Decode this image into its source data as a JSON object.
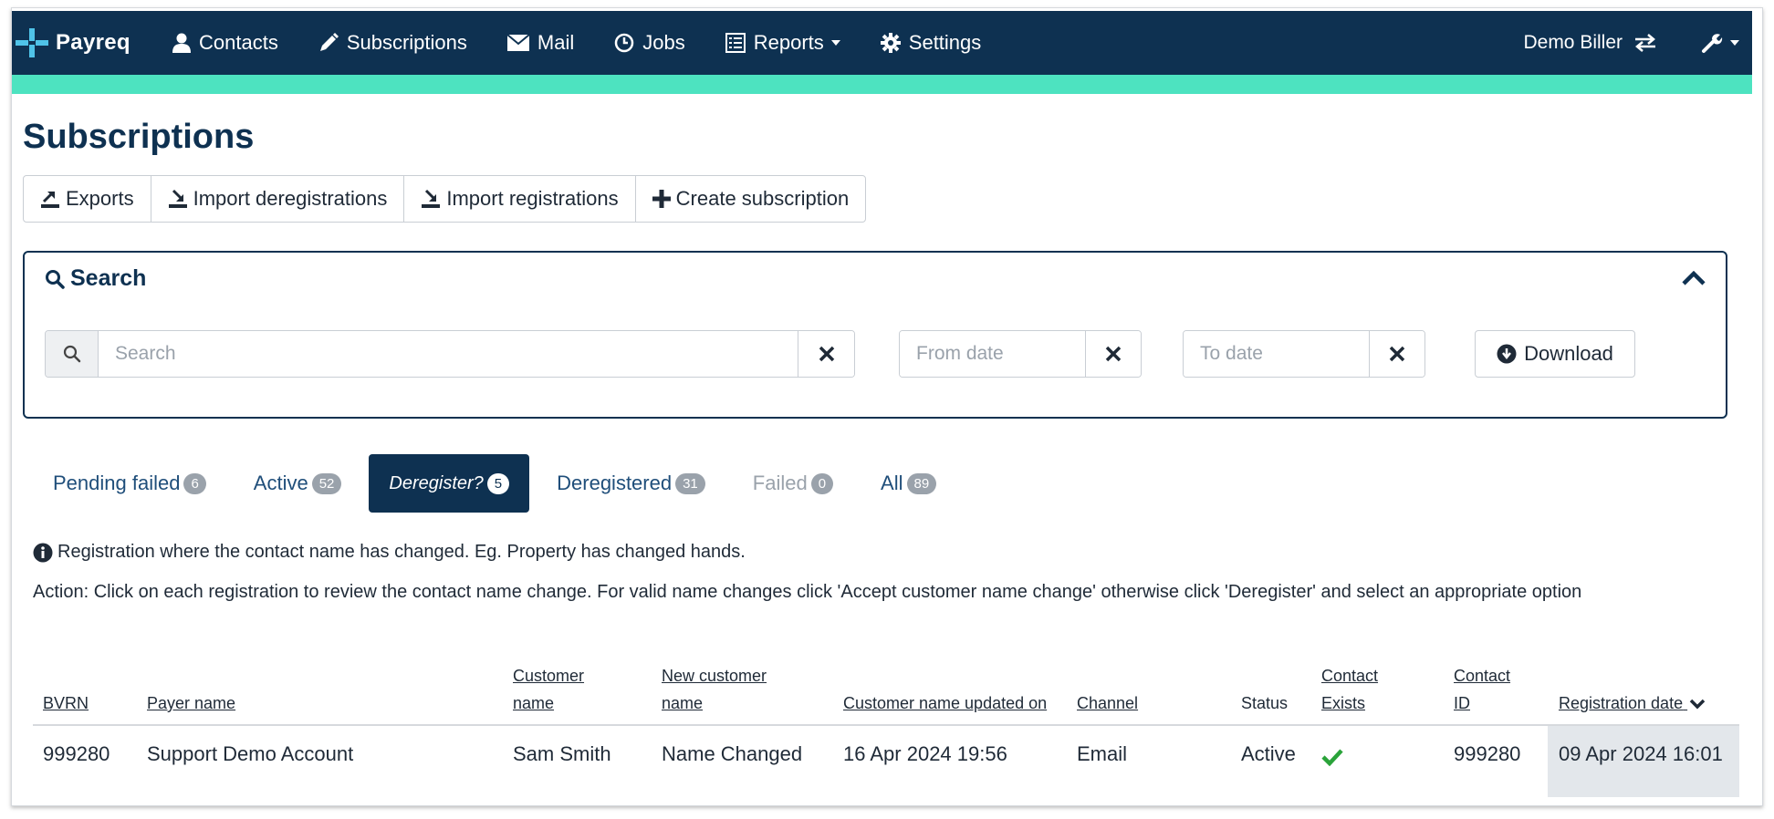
{
  "nav": {
    "brand": "Payreq",
    "items": [
      {
        "label": "Contacts",
        "icon": "user-icon"
      },
      {
        "label": "Subscriptions",
        "icon": "pencil-icon"
      },
      {
        "label": "Mail",
        "icon": "envelope-icon"
      },
      {
        "label": "Jobs",
        "icon": "clock-icon"
      },
      {
        "label": "Reports",
        "icon": "list-icon"
      },
      {
        "label": "Settings",
        "icon": "gear-icon"
      }
    ],
    "user": "Demo Biller"
  },
  "colors": {
    "navy": "#0e3151",
    "accent": "#4de3c0",
    "brand_logo": "#4fc3e8",
    "check": "#2aa33a"
  },
  "page": {
    "title": "Subscriptions"
  },
  "actions": {
    "exports": "Exports",
    "import_deregistrations": "Import deregistrations",
    "import_registrations": "Import registrations",
    "create_subscription": "Create subscription"
  },
  "search": {
    "heading": "Search",
    "search_placeholder": "Search",
    "from_placeholder": "From date",
    "to_placeholder": "To date",
    "download_label": "Download"
  },
  "tabs": [
    {
      "label": "Pending failed",
      "count": "6"
    },
    {
      "label": "Active",
      "count": "52"
    },
    {
      "label": "Deregister?",
      "count": "5"
    },
    {
      "label": "Deregistered",
      "count": "31"
    },
    {
      "label": "Failed",
      "count": "0"
    },
    {
      "label": "All",
      "count": "89"
    }
  ],
  "info": {
    "description": "Registration where the contact name has changed. Eg. Property has changed hands.",
    "action": "Action: Click on each registration to review the contact name change. For valid name changes click 'Accept customer name change' otherwise click 'Deregister' and select an appropriate option"
  },
  "table": {
    "headers": {
      "bvrn": "BVRN",
      "payer_name": "Payer name",
      "customer_name": "Customer name",
      "new_customer_name": "New customer name",
      "name_updated_on": "Customer name updated on",
      "channel": "Channel",
      "status": "Status",
      "contact_exists": "Contact Exists",
      "contact_id": "Contact ID",
      "registration_date": "Registration date"
    },
    "rows": [
      {
        "bvrn": "999280",
        "payer_name": "Support Demo Account",
        "customer_name": "Sam Smith",
        "new_customer_name": "Name Changed",
        "name_updated_on": "16 Apr 2024 19:56",
        "channel": "Email",
        "status": "Active",
        "contact_exists": true,
        "contact_id": "999280",
        "registration_date": "09 Apr 2024 16:01"
      }
    ]
  }
}
